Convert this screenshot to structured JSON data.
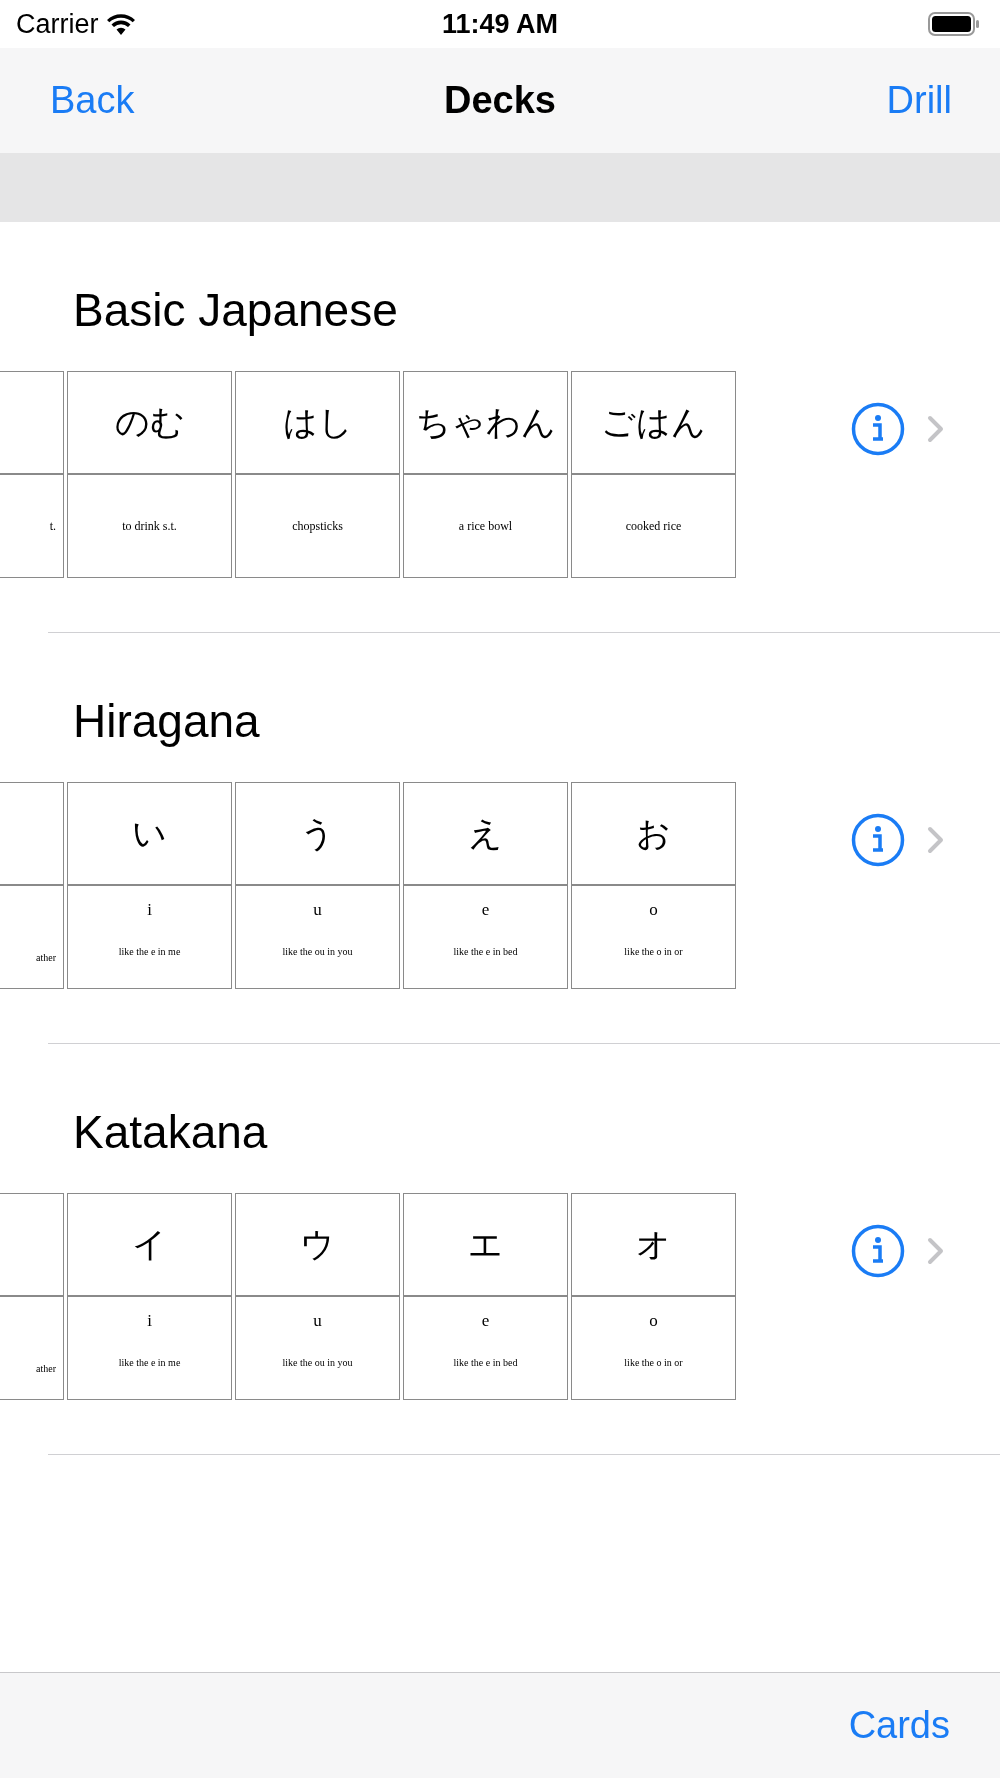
{
  "status_bar": {
    "carrier": "Carrier",
    "time": "11:49 AM"
  },
  "nav_bar": {
    "back": "Back",
    "title": "Decks",
    "action": "Drill"
  },
  "decks": [
    {
      "title": "Basic Japanese",
      "cards": [
        {
          "kind": "partial",
          "back": {
            "meaning": "t."
          }
        },
        {
          "kind": "word",
          "front": "のむ",
          "back": {
            "meaning": "to drink s.t."
          }
        },
        {
          "kind": "word",
          "front": "はし",
          "back": {
            "meaning": "chopsticks"
          }
        },
        {
          "kind": "compact",
          "front": "ちゃわん",
          "back": {
            "meaning": "a rice bowl"
          }
        },
        {
          "kind": "word",
          "front": "ごはん",
          "back": {
            "meaning": "cooked rice"
          }
        }
      ]
    },
    {
      "title": "Hiragana",
      "cards": [
        {
          "kind": "partial",
          "back": {
            "note": "ather"
          }
        },
        {
          "kind": "glyph",
          "front": "い",
          "back": {
            "romaji": "i",
            "note": "like the e in me"
          }
        },
        {
          "kind": "glyph",
          "front": "う",
          "back": {
            "romaji": "u",
            "note": "like the ou in you"
          }
        },
        {
          "kind": "glyph",
          "front": "え",
          "back": {
            "romaji": "e",
            "note": "like the e in bed"
          }
        },
        {
          "kind": "glyph",
          "front": "お",
          "back": {
            "romaji": "o",
            "note": "like the o in or"
          }
        }
      ]
    },
    {
      "title": "Katakana",
      "cards": [
        {
          "kind": "partial",
          "back": {
            "note": "ather"
          }
        },
        {
          "kind": "glyph",
          "front": "イ",
          "back": {
            "romaji": "i",
            "note": "like the e in me"
          }
        },
        {
          "kind": "glyph",
          "front": "ウ",
          "back": {
            "romaji": "u",
            "note": "like the ou in you"
          }
        },
        {
          "kind": "glyph",
          "front": "エ",
          "back": {
            "romaji": "e",
            "note": "like the e in bed"
          }
        },
        {
          "kind": "glyph",
          "front": "オ",
          "back": {
            "romaji": "o",
            "note": "like the o in or"
          }
        }
      ]
    }
  ],
  "toolbar": {
    "button": "Cards"
  }
}
